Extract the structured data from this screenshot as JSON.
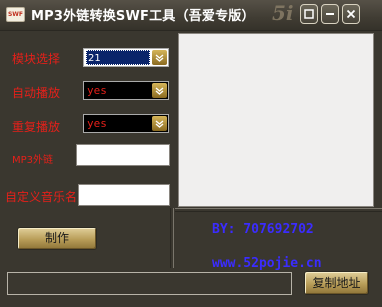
{
  "window": {
    "app_icon_text": "SWF",
    "title": "MP3外链转换SWF工具（吾爱专版）",
    "deco_text": "5i"
  },
  "form": {
    "module_label": "模块选择",
    "module_value": "21",
    "autoplay_label": "自动播放",
    "autoplay_value": "yes",
    "repeat_label": "重复播放",
    "repeat_value": "yes",
    "mp3_label": "MP3外链",
    "mp3_value": "",
    "name_label": "自定义音乐名",
    "name_value": "",
    "make_button": "制作"
  },
  "credits": {
    "by": "BY: 707692702",
    "site": "www.52pojie.cn"
  },
  "output": {
    "value": "",
    "copy_button": "复制地址"
  },
  "colors": {
    "label_red": "#e4201a",
    "credit_blue": "#3b2cff",
    "background": "#3a372f",
    "button_gold": "#b89d58"
  }
}
